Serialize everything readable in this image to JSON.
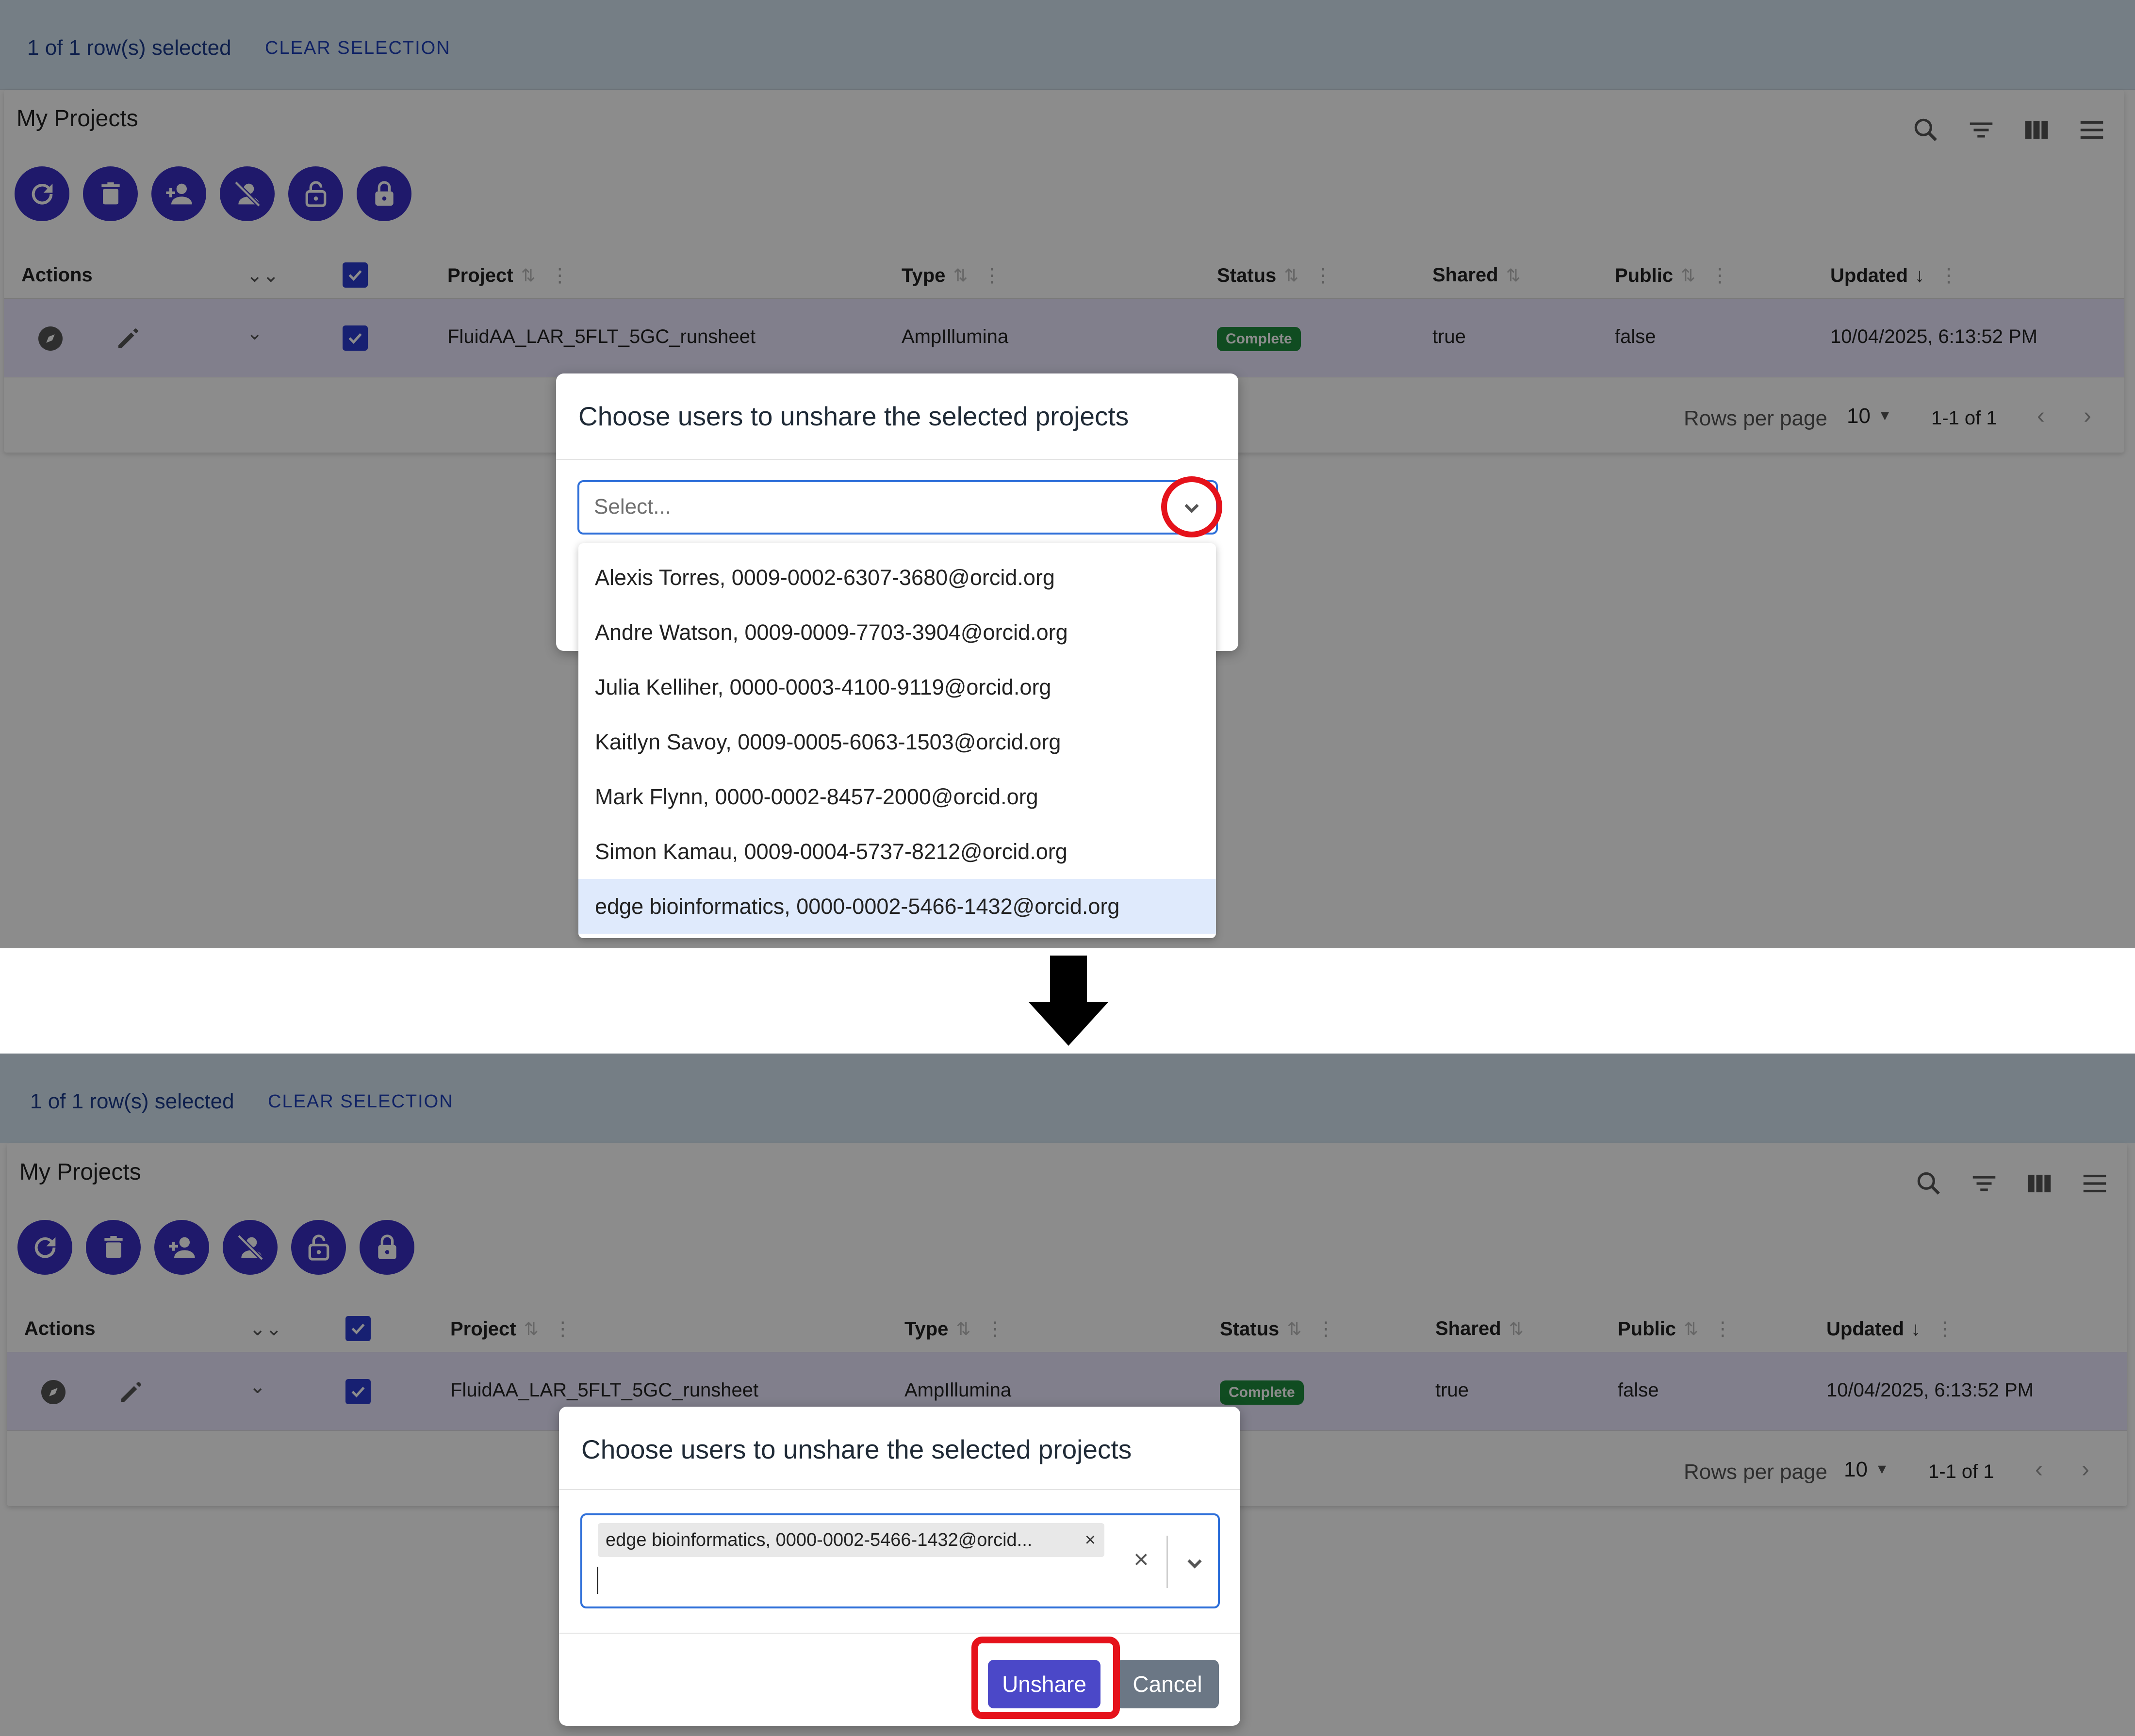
{
  "selection": {
    "count_text": "1 of 1 row(s) selected",
    "clear_label": "CLEAR SELECTION"
  },
  "card": {
    "title": "My Projects"
  },
  "toolbar_icons": [
    "search-icon",
    "filter-icon",
    "columns-icon",
    "menu-icon"
  ],
  "action_buttons": [
    "refresh-icon",
    "delete-icon",
    "share-user-icon",
    "unshare-user-icon",
    "unlock-icon",
    "lock-icon"
  ],
  "columns": {
    "actions": "Actions",
    "project": "Project",
    "type": "Type",
    "status": "Status",
    "shared": "Shared",
    "public": "Public",
    "updated": "Updated"
  },
  "row": {
    "project": "FluidAA_LAR_5FLT_5GC_runsheet",
    "type": "AmpIllumina",
    "status": "Complete",
    "shared": "true",
    "public": "false",
    "updated": "10/04/2025, 6:13:52 PM"
  },
  "pagination": {
    "rows_per_page_label": "Rows per page",
    "rows_per_page_value": "10",
    "range": "1-1 of 1"
  },
  "modal": {
    "title": "Choose users to unshare the selected projects",
    "placeholder": "Select...",
    "options": [
      "Alexis Torres, 0009-0002-6307-3680@orcid.org",
      "Andre Watson, 0009-0009-7703-3904@orcid.org",
      "Julia Kelliher, 0000-0003-4100-9119@orcid.org",
      "Kaitlyn Savoy, 0009-0005-6063-1503@orcid.org",
      "Mark Flynn, 0000-0002-8457-2000@orcid.org",
      "Simon Kamau, 0009-0004-5737-8212@orcid.org",
      "edge bioinformatics, 0000-0002-5466-1432@orcid.org"
    ],
    "selected_chip": "edge bioinformatics, 0000-0002-5466-1432@orcid...",
    "chip_remove": "×",
    "clear_all": "×",
    "unshare_label": "Unshare",
    "cancel_label": "Cancel"
  },
  "colors": {
    "accent": "#3a2fc4",
    "checkbox": "#2b3bd0",
    "status_complete": "#1e8a3c",
    "highlight_red": "#e5121b",
    "selection_bar": "#d6e6f2"
  }
}
